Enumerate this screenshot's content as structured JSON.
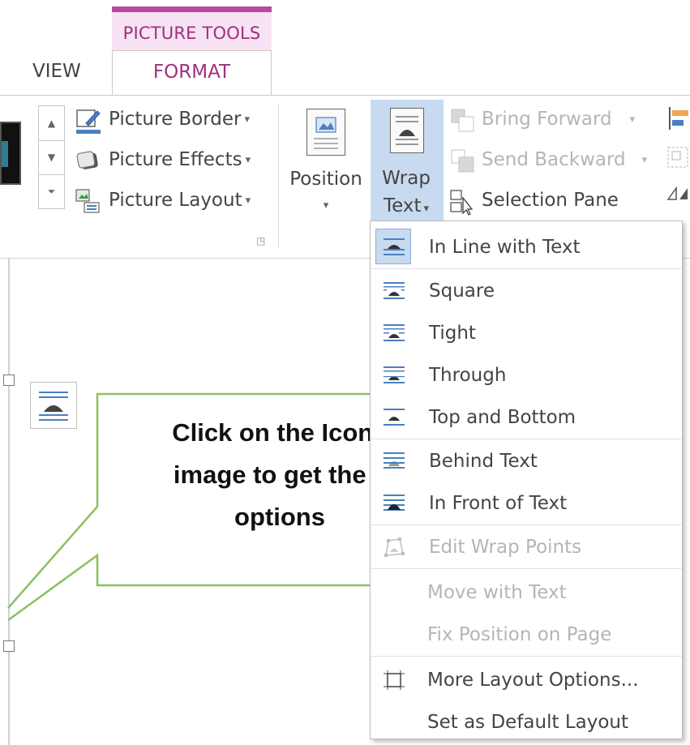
{
  "ribbon": {
    "context_tab": "PICTURE TOOLS",
    "tabs": [
      {
        "label": "VIEW"
      },
      {
        "label": "FORMAT",
        "selected": true
      }
    ],
    "picture_styles_group": {
      "buttons": [
        {
          "label": "Picture Border",
          "icon": "picture-border-icon"
        },
        {
          "label": "Picture Effects",
          "icon": "picture-effects-icon"
        },
        {
          "label": "Picture Layout",
          "icon": "picture-layout-icon"
        }
      ]
    },
    "arrange_group": {
      "position_label": "Position",
      "wrap_label_line1": "Wrap",
      "wrap_label_line2": "Text",
      "buttons": [
        {
          "label": "Bring Forward",
          "enabled": false
        },
        {
          "label": "Send Backward",
          "enabled": false
        },
        {
          "label": "Selection Pane",
          "enabled": true
        }
      ]
    }
  },
  "document": {
    "callout_line1": "Click on the Icon b",
    "callout_line2": "image to get the la",
    "callout_line3": "options"
  },
  "wrap_menu": {
    "items": [
      {
        "label": "In Line with Text",
        "icon": "in-line-with-text-icon",
        "enabled": true,
        "highlighted": true
      },
      {
        "label": "Square",
        "icon": "square-wrap-icon",
        "enabled": true
      },
      {
        "label": "Tight",
        "icon": "tight-wrap-icon",
        "enabled": true
      },
      {
        "label": "Through",
        "icon": "through-wrap-icon",
        "enabled": true
      },
      {
        "label": "Top and Bottom",
        "icon": "top-and-bottom-icon",
        "enabled": true
      },
      {
        "label": "Behind Text",
        "icon": "behind-text-icon",
        "enabled": true
      },
      {
        "label": "In Front of Text",
        "icon": "in-front-of-text-icon",
        "enabled": true
      },
      {
        "label": "Edit Wrap Points",
        "icon": "edit-wrap-points-icon",
        "enabled": false
      },
      {
        "label": "Move with Text",
        "enabled": false
      },
      {
        "label": "Fix Position on Page",
        "enabled": false
      },
      {
        "label": "More Layout Options...",
        "icon": "more-layout-options-icon",
        "enabled": true
      },
      {
        "label": "Set as Default Layout",
        "enabled": true
      }
    ]
  },
  "colors": {
    "accent_pink": "#a0307e",
    "highlight_blue": "#c7daf0",
    "callout_border": "#8cc063"
  }
}
